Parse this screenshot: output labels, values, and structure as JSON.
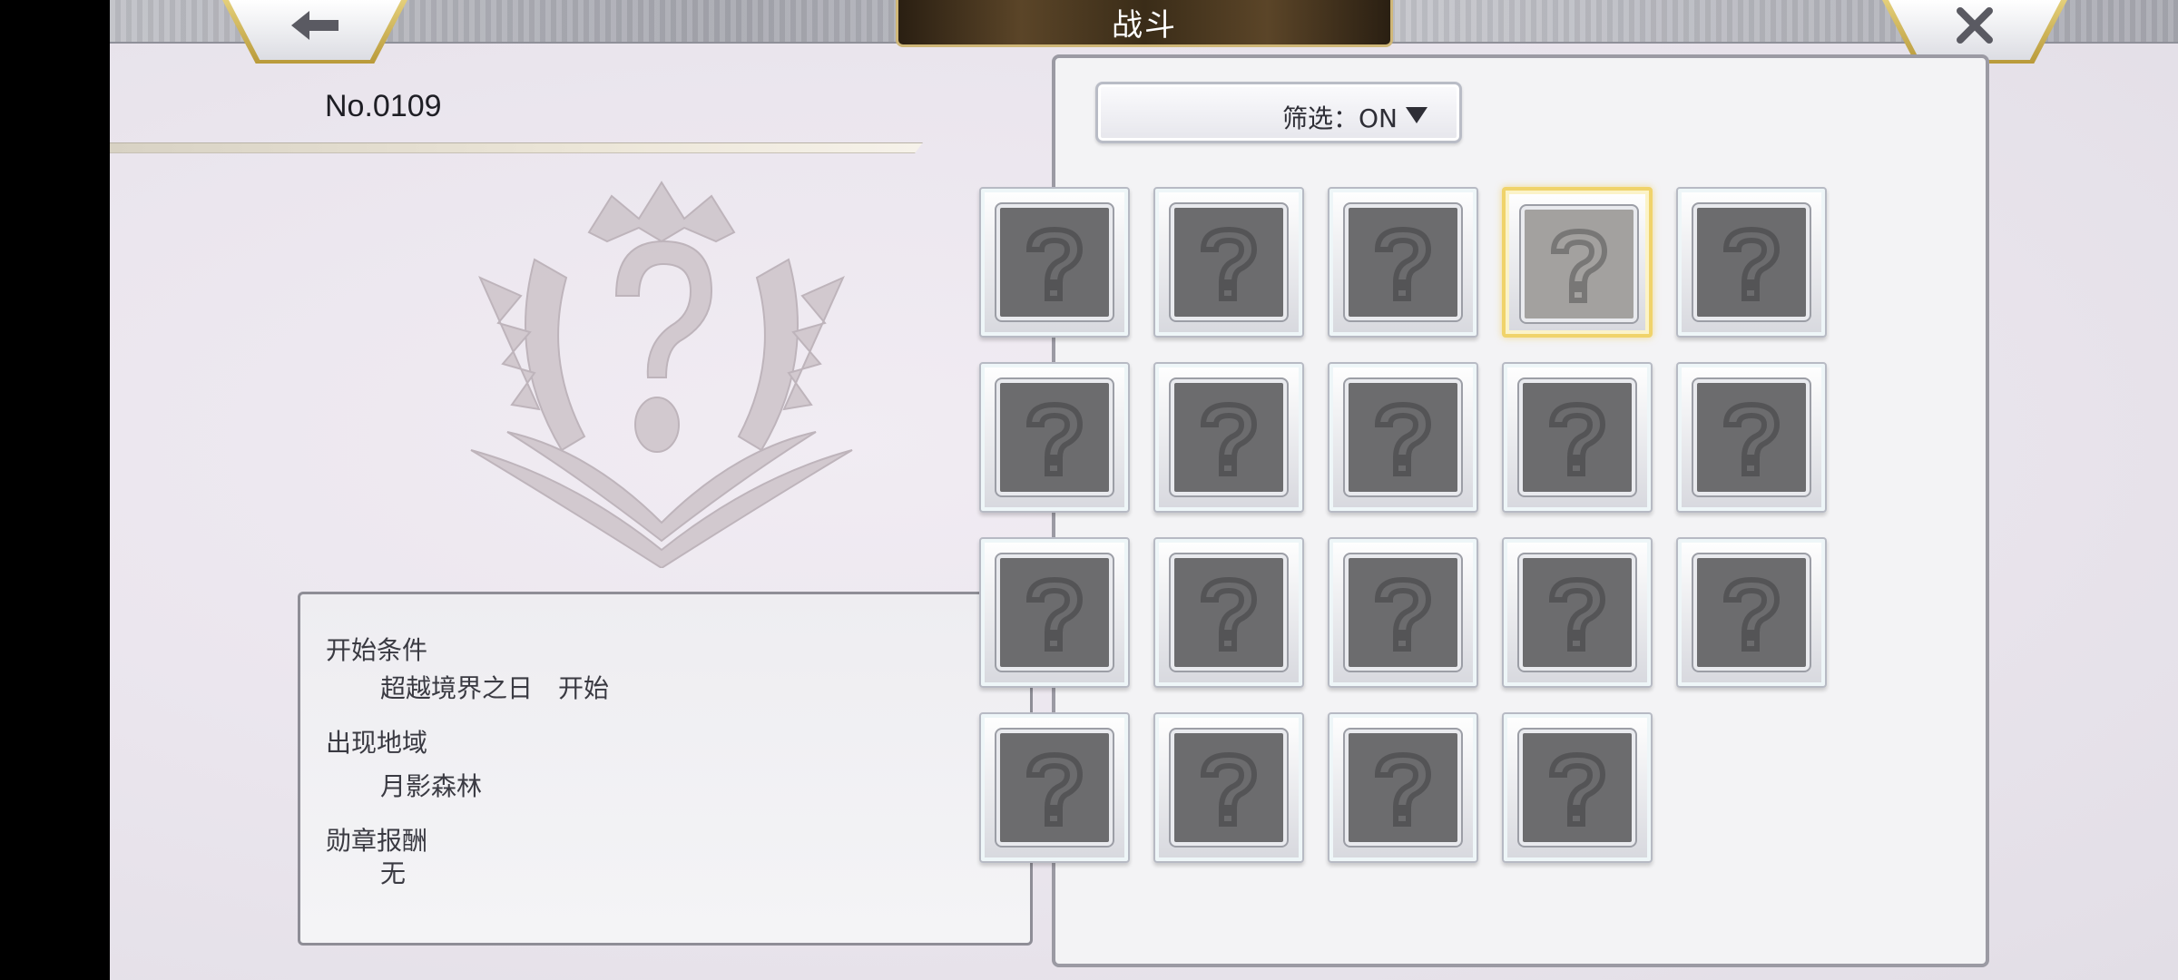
{
  "header": {
    "title": "战斗",
    "back_icon": "left-arrow-icon",
    "close_icon": "close-icon"
  },
  "entry": {
    "number": "No.0109",
    "emblem_icon": "unknown-question-emblem-icon"
  },
  "info": {
    "start_condition_label": "开始条件",
    "start_condition_value": "超越境界之日　开始",
    "region_label": "出现地域",
    "region_value": "月影森林",
    "medal_reward_label": "勋章报酬",
    "medal_reward_value": "无"
  },
  "filter": {
    "label": "筛选：ON",
    "icon": "dropdown-triangle-icon"
  },
  "grid": {
    "slot_icon": "question-mark-icon",
    "slot_count": 19,
    "selected_index": 3,
    "colors": {
      "selected_border": "#f0d36a",
      "locked_fill": "#6c6c6e"
    }
  }
}
